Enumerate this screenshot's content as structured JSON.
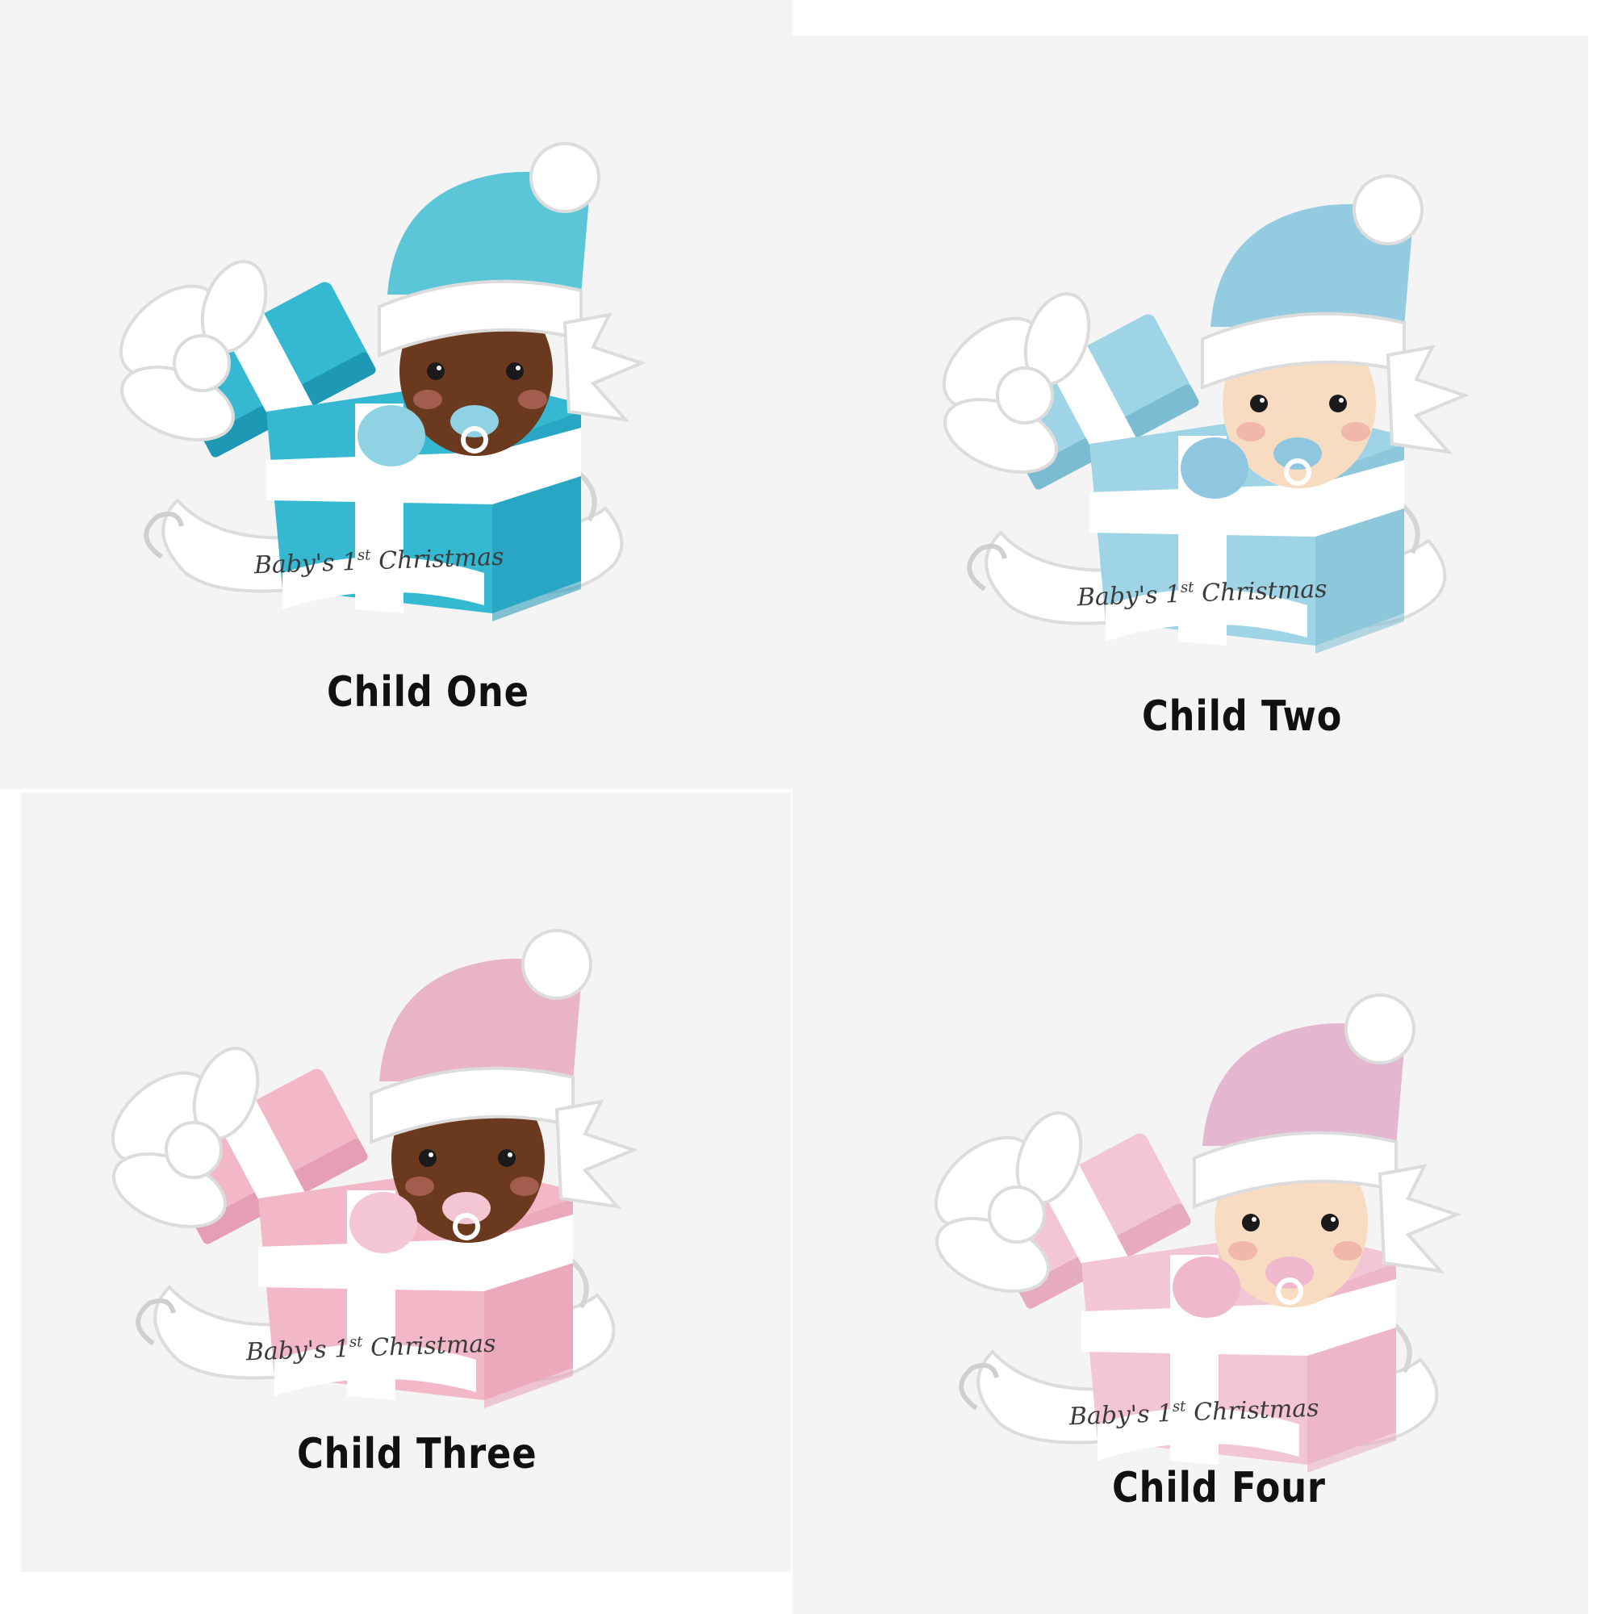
{
  "ornaments": [
    {
      "label": "Child One",
      "banner": {
        "pre": "Baby's 1",
        "sup": "st",
        "post": " Christmas"
      },
      "colors": {
        "gift": "#35b9d3",
        "gift_dark": "#1f98b6",
        "hat": "#5cc6d9",
        "skin": "#6b3a1e",
        "pacifier": "#8fd2e3"
      }
    },
    {
      "label": "Child Two",
      "banner": {
        "pre": "Baby's 1",
        "sup": "st",
        "post": " Christmas"
      },
      "colors": {
        "gift": "#9fd4e6",
        "gift_dark": "#7cbcd3",
        "hat": "#93cbe0",
        "skin": "#f7dcc1",
        "pacifier": "#8fc6e0"
      }
    },
    {
      "label": "Child Three",
      "banner": {
        "pre": "Baby's 1",
        "sup": "st",
        "post": " Christmas"
      },
      "colors": {
        "gift": "#f2b8c8",
        "gift_dark": "#e59eb3",
        "hat": "#eab4c8",
        "skin": "#6b3a1e",
        "pacifier": "#f4c6d4"
      }
    },
    {
      "label": "Child Four",
      "banner": {
        "pre": "Baby's 1",
        "sup": "st",
        "post": " Christmas"
      },
      "colors": {
        "gift": "#f3c6d6",
        "gift_dark": "#e7abc0",
        "hat": "#e4b6cf",
        "skin": "#f7dcc1",
        "pacifier": "#f0b8cc"
      }
    }
  ]
}
